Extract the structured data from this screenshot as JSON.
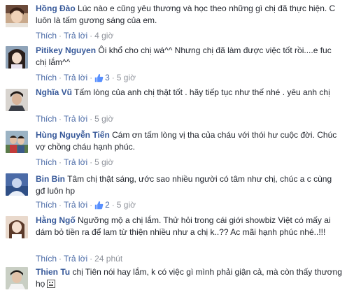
{
  "actions": {
    "like": "Thích",
    "reply": "Trả lời",
    "sep": "·"
  },
  "comments": [
    {
      "name": "Hồng Đào",
      "text": "Lúc nào e cũng yêu thương và học theo những gì chị đã thực hiện. C luôn là tấm gương sáng của em.",
      "time": "4 giờ"
    },
    {
      "name": "Pitikey Nguyen",
      "text": "Ôi khổ cho chị wá^^ Nhưng chị đã làm được việc tốt rồi....e fuc chị lắm^^",
      "likes": "3",
      "time": "5 giờ"
    },
    {
      "name": "Nghĩa Vũ",
      "text": "Tấm lòng của anh chị thật tốt . hãy tiếp tục như thế nhé . yêu anh chị",
      "time": "5 giờ"
    },
    {
      "name": "Hùng Nguyễn Tiến",
      "text": "Cám ơn tấm lòng vị tha của cháu với thói hư cuộc đời. Chúc vợ chồng cháu hạnh phúc.",
      "time": "5 giờ"
    },
    {
      "name": "Bin Bin",
      "text": "Tâm chị thật sáng, ước sao nhiều người có tâm như chị, chúc a c cùng gđ luôn hp",
      "likes": "2",
      "time": "5 giờ"
    },
    {
      "name": "Hằng Ngố",
      "text": "Ngưỡng mộ a chị lắm. Thử hỏi trong cái giới showbiz Việt có mấy ai dám bỏ tiền ra để lam từ thiện nhiều như a chị k..?? Ac mãi hạnh phúc nhé..!!!",
      "time": "24 phút"
    },
    {
      "name": "Thien Tu",
      "text": "chị Tiên nói hay lắm, k có việc gì mình phải giận cả, mà còn thấy thương họ"
    }
  ],
  "colors": {
    "name": "#365899",
    "link": "#4b6ba7",
    "meta": "#90949c",
    "text": "#1d2129"
  }
}
